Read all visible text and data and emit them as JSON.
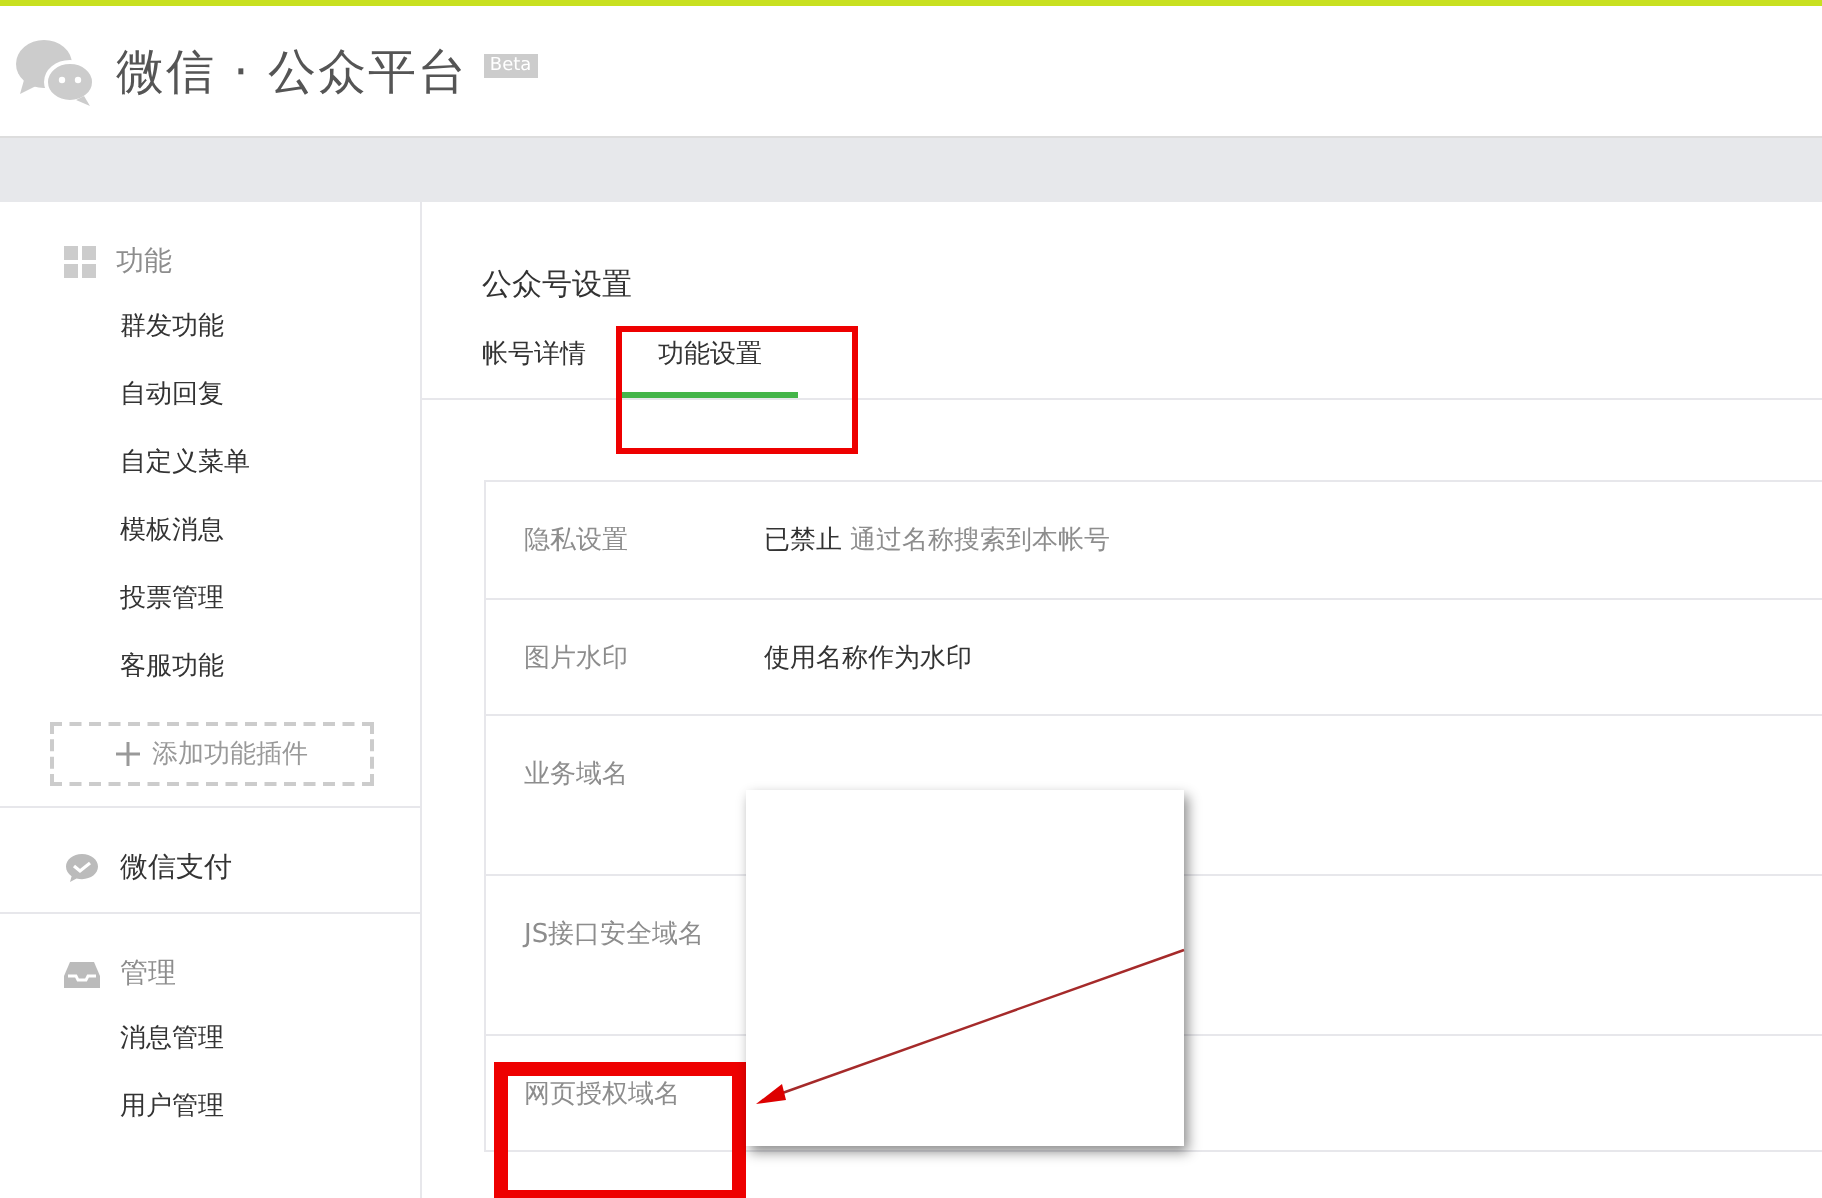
{
  "header": {
    "title": "微信 · 公众平台",
    "badge": "Beta"
  },
  "sidebar": {
    "sections": [
      {
        "label": "功能",
        "items": [
          "群发功能",
          "自动回复",
          "自定义菜单",
          "模板消息",
          "投票管理",
          "客服功能"
        ],
        "add_button": "添加功能插件"
      },
      {
        "label": "微信支付"
      },
      {
        "label": "管理",
        "items": [
          "消息管理",
          "用户管理"
        ]
      }
    ]
  },
  "page_title": "公众号设置",
  "tabs": [
    {
      "label": "帐号详情",
      "selected": false
    },
    {
      "label": "功能设置",
      "selected": true
    }
  ],
  "settings": [
    {
      "label": "隐私设置",
      "value": "已禁止",
      "note": "通过名称搜索到本帐号"
    },
    {
      "label": "图片水印",
      "value": "使用名称作为水印"
    },
    {
      "label": "业务域名"
    },
    {
      "label": "JS接口安全域名"
    },
    {
      "label": "网页授权域名"
    }
  ]
}
